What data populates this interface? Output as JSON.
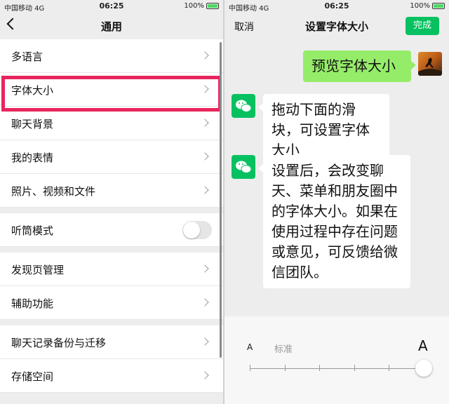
{
  "status": {
    "carrier": "中国移动 4G",
    "time": "06:25",
    "battery": "100%"
  },
  "left": {
    "title": "通用",
    "items": [
      {
        "label": "多语言"
      },
      {
        "label": "字体大小"
      },
      {
        "label": "聊天背景"
      },
      {
        "label": "我的表情"
      },
      {
        "label": "照片、视频和文件"
      },
      {
        "label": "听筒模式"
      },
      {
        "label": "发现页管理"
      },
      {
        "label": "辅助功能"
      },
      {
        "label": "聊天记录备份与迁移"
      },
      {
        "label": "存储空间"
      }
    ],
    "earpiece_mode_on": false,
    "highlight_color": "#e8265e"
  },
  "right": {
    "title": "设置字体大小",
    "cancel_label": "取消",
    "done_label": "完成",
    "messages": [
      {
        "text": "预览字体大小"
      },
      {
        "text": "拖动下面的滑块，可设置字体大小"
      },
      {
        "text": "设置后，会改变聊天、菜单和朋友圈中的字体大小。如果在使用过程中存在问题或意见，可反馈给微信团队。"
      }
    ],
    "slider": {
      "small_label": "A",
      "standard_label": "标准",
      "large_label": "A",
      "position": 1.0,
      "steps": 6
    }
  },
  "colors": {
    "accent": "#07c160",
    "self_bubble": "#95ec69"
  }
}
